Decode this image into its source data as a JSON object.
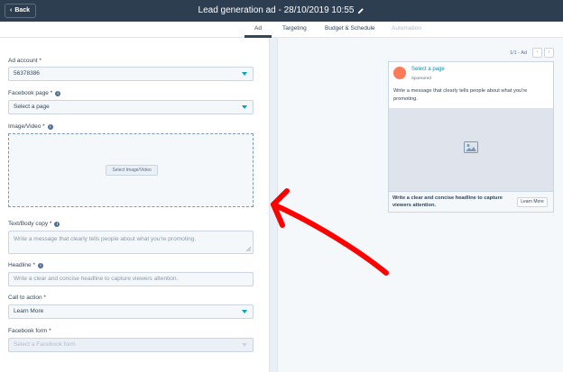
{
  "header": {
    "back_label": "Back",
    "title": "Lead generation ad - 28/10/2019 10:55"
  },
  "tabs": [
    {
      "label": "Ad",
      "state": "active"
    },
    {
      "label": "Targeting",
      "state": "normal"
    },
    {
      "label": "Budget & Schedule",
      "state": "normal"
    },
    {
      "label": "Automation",
      "state": "disabled"
    }
  ],
  "form": {
    "ad_account": {
      "label": "Ad account *",
      "value": "56378386"
    },
    "facebook_page": {
      "label": "Facebook page *",
      "value": "Select a page"
    },
    "image_video": {
      "label": "Image/Video *",
      "button": "Select Image/Video"
    },
    "body_copy": {
      "label": "Text/Body copy *",
      "placeholder": "Write a message that clearly tells people about what you're promoting."
    },
    "headline": {
      "label": "Headline *",
      "placeholder": "Write a clear and concise headline to capture viewers attention."
    },
    "call_to_action": {
      "label": "Call to action *",
      "value": "Learn More"
    },
    "facebook_form": {
      "label": "Facebook form *",
      "value": "Select a Facebook form"
    }
  },
  "preview": {
    "pager": "1/1 - Ad",
    "page_name": "Select a page",
    "sponsored": "Sponsored",
    "body": "Write a message that clearly tells people about what you're promoting.",
    "headline": "Write a clear and concise headline to capture viewers attention.",
    "cta": "Learn More"
  },
  "colors": {
    "header_bg": "#2d3e50",
    "accent": "#00a4bd",
    "link": "#0091ae",
    "avatar": "#ff7a59",
    "annotation": "#ff0000"
  }
}
